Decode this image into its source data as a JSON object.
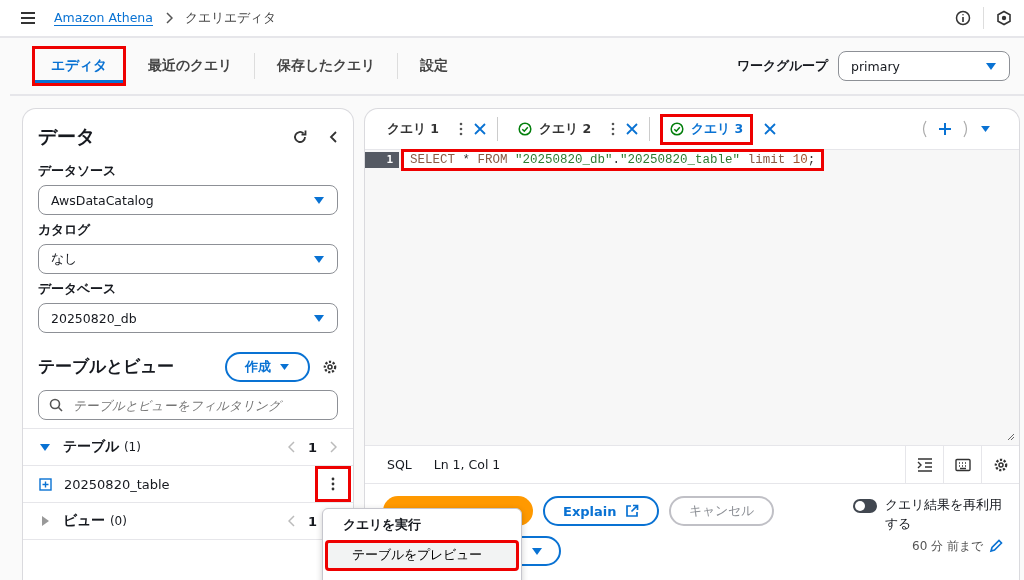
{
  "breadcrumb": [
    {
      "label": "Amazon Athena",
      "kind": "link"
    },
    {
      "label": "クエリエディタ",
      "kind": "current"
    }
  ],
  "nav_tabs": [
    {
      "label": "エディタ",
      "selected": true,
      "highlighted": true
    },
    {
      "label": "最近のクエリ",
      "selected": false,
      "highlighted": false
    },
    {
      "label": "保存したクエリ",
      "selected": false,
      "highlighted": false
    },
    {
      "label": "設定",
      "selected": false,
      "highlighted": false
    }
  ],
  "workgroup": {
    "label": "ワークグループ",
    "value": "primary"
  },
  "data_panel": {
    "title": "データ",
    "fields": [
      {
        "label": "データソース",
        "value": "AwsDataCatalog"
      },
      {
        "label": "カタログ",
        "value": "なし"
      },
      {
        "label": "データベース",
        "value": "20250820_db"
      }
    ],
    "tables_title": "テーブルとビュー",
    "create_button": "作成",
    "filter": {
      "placeholder": "テーブルとビューをフィルタリング"
    },
    "sections": [
      {
        "label": "テーブル",
        "count": "(1)",
        "expanded": true,
        "page": "1",
        "items": [
          {
            "name": "20250820_table",
            "highlighted": true
          }
        ]
      },
      {
        "label": "ビュー",
        "count": "(0)",
        "expanded": false,
        "page": "1"
      }
    ]
  },
  "query_tabs": [
    {
      "label": "クエリ 1",
      "succeeded": false,
      "selected": false,
      "highlighted": false
    },
    {
      "label": "クエリ 2",
      "succeeded": true,
      "selected": false,
      "highlighted": false
    },
    {
      "label": "クエリ 3",
      "succeeded": true,
      "selected": true,
      "highlighted": true
    }
  ],
  "editor": {
    "lines": [
      {
        "number": "1",
        "highlighted": true,
        "tokens": [
          {
            "text": "SELECT",
            "kind": "keyword"
          },
          {
            "text": " * ",
            "kind": "plain"
          },
          {
            "text": "FROM",
            "kind": "keyword"
          },
          {
            "text": " \"20250820_db\"",
            "kind": "string"
          },
          {
            "text": ".",
            "kind": "plain"
          },
          {
            "text": "\"20250820_table\"",
            "kind": "string"
          },
          {
            "text": " limit ",
            "kind": "keyword"
          },
          {
            "text": "10",
            "kind": "number"
          },
          {
            "text": ";",
            "kind": "plain"
          }
        ]
      }
    ]
  },
  "status_bar": {
    "language": "SQL",
    "position": "Ln 1, Col 1"
  },
  "actions": {
    "explain": "Explain",
    "cancel": "キャンセル",
    "reuse": {
      "label": "クエリ結果を再利用する",
      "on": false,
      "age": "60 分 前まで"
    }
  },
  "context_menu": {
    "items": [
      {
        "label": "クエリを実行",
        "kind": "header"
      },
      {
        "label": "テーブルをプレビュー",
        "kind": "item",
        "highlighted": true
      }
    ]
  }
}
